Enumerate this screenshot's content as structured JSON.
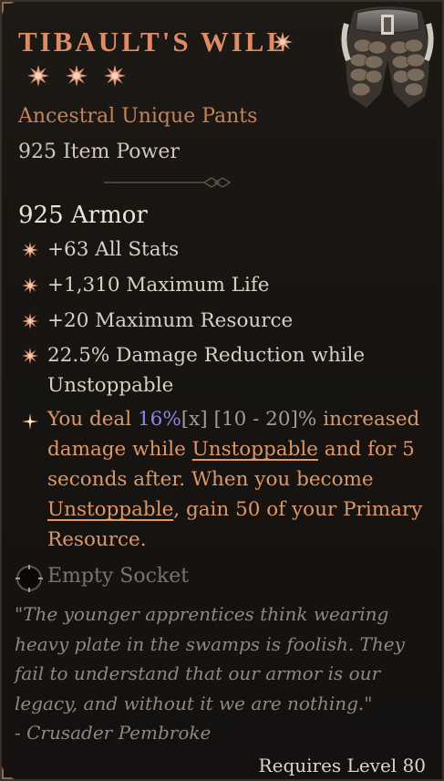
{
  "item": {
    "name": "TIBAULT'S WILL",
    "rarity_type": "Ancestral Unique Pants",
    "item_power": "925 Item Power",
    "armor": "925 Armor",
    "affixes": [
      "+63 All Stats",
      "+1,310 Maximum Life",
      "+20 Maximum Resource",
      "22.5% Damage Reduction while Unstoppable"
    ],
    "unique_effect": {
      "prefix": "You deal ",
      "value": "16%",
      "roll_marker": "[x]",
      "range": " [10 - 20]%",
      "part1": " increased damage while ",
      "keyword1": "Unstoppable",
      "part2": " and for 5 seconds after. When you become ",
      "keyword2": "Unstoppable",
      "part3": ", gain 50 of your Primary Resource."
    },
    "socket_label": "Empty Socket",
    "flavor_text": "\"The younger apprentices think wearing heavy plate in the swamps is foolish. They fail to understand that our armor is our legacy, and without it we are nothing.\"",
    "flavor_author": "- Crusader Pembroke",
    "requirement": "Requires Level 80",
    "star_count": 3
  },
  "colors": {
    "title": "#dd8c66",
    "rarity": "#c98257",
    "unique_effect": "#dd9869",
    "rolled_value": "#8d86e6",
    "flavor": "#8f8880",
    "background": "#171411"
  },
  "icons": {
    "affix_bullet": "affix-star-icon",
    "unique_bullet": "unique-star-icon",
    "socket": "empty-socket-icon",
    "greater_affix": "greater-affix-star-icon",
    "item_image": "pants-armor-image"
  }
}
